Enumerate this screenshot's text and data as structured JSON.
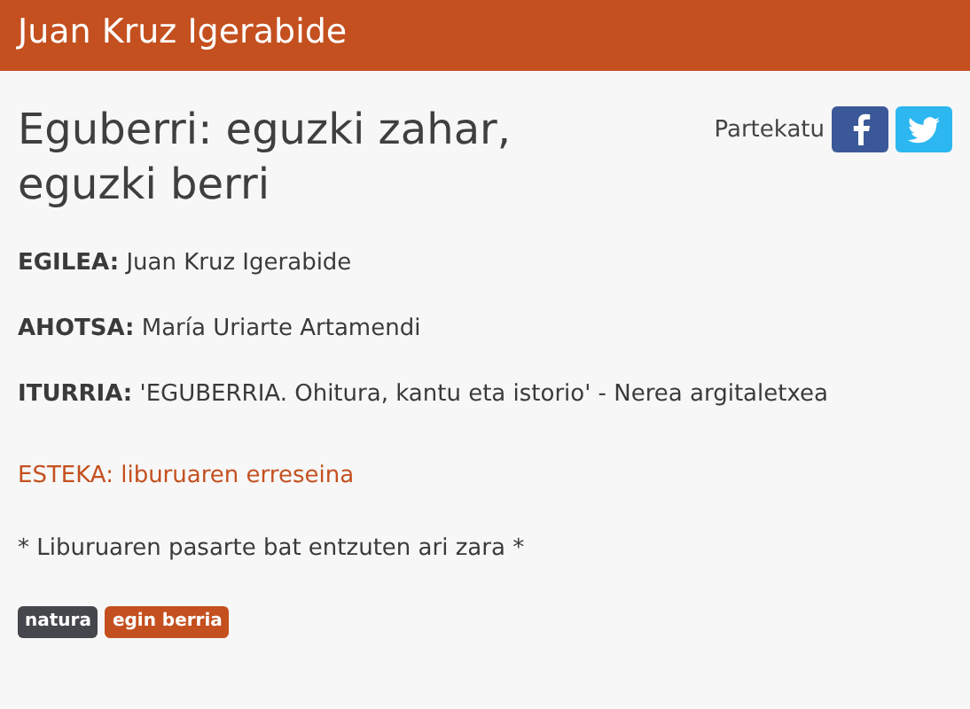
{
  "header": {
    "title": "Juan Kruz Igerabide"
  },
  "article": {
    "title": "Eguberri: eguzki zahar, eguzki berri",
    "share": {
      "label": "Partekatu",
      "buttons": [
        {
          "kind": "facebook"
        },
        {
          "kind": "twitter"
        }
      ]
    },
    "fields": [
      "**EGILEA:** Juan Kruz Igerabide",
      "**AHOTSA:** María Uriarte Artamendi",
      "**ITURRIA:** 'EGUBERRIA. Ohitura, kantu eta istorio' - Nerea argitaletxea"
    ],
    "link": "ESTEKA: liburuaren erreseina",
    "note": "* Liburuaren pasarte bat entzuten ari zara *",
    "tags": [
      {
        "label": "natura",
        "color": "#45474d"
      },
      {
        "label": "egin berria",
        "color": "#c4501f"
      }
    ]
  }
}
